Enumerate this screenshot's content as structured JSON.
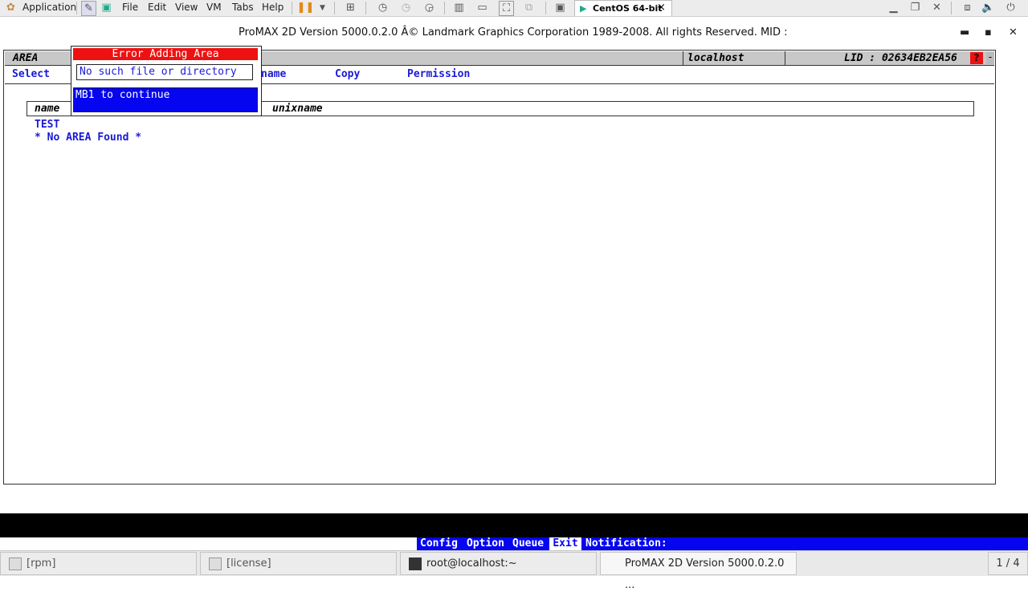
{
  "topbar": {
    "applications": "Application",
    "menu": [
      "File",
      "Edit",
      "View",
      "VM",
      "Tabs",
      "Help"
    ],
    "vm_tab": "CentOS 64-bit",
    "vm_tab_close": "×"
  },
  "window": {
    "title": "ProMAX 2D   Version 5000.0.2.0   Â© Landmark Graphics Corporation 1989-2008. All rights Reserved.    MID :",
    "minimize": "▬",
    "maximize": "▪",
    "close": "✕"
  },
  "panel": {
    "area_label": "AREA",
    "host": "localhost",
    "lid": "LID : 02634EB2EA56",
    "help": "?",
    "menu": {
      "select": "Select",
      "rename": "name",
      "copy": "Copy",
      "permission": "Permission"
    },
    "table": {
      "col_name": "name",
      "col_unix": "unixname"
    },
    "rows": [
      "TEST",
      "* No AREA Found *"
    ]
  },
  "popup": {
    "title": "Error Adding Area",
    "message": "No such file or directory",
    "button": "MB1 to continue"
  },
  "status": {
    "config": "Config",
    "option": "Option",
    "queue": "Queue",
    "exit": "Exit",
    "notification": "Notification:"
  },
  "taskbar": {
    "tasks": [
      "[rpm]",
      "[license]",
      "root@localhost:~",
      "ProMAX 2D   Version 5000.0.2.0   ..."
    ],
    "pager": "1 / 4"
  },
  "colors": {
    "menu_blue": "#1a1ad6",
    "popup_red": "#ee1111",
    "popup_blue": "#0505f0"
  }
}
